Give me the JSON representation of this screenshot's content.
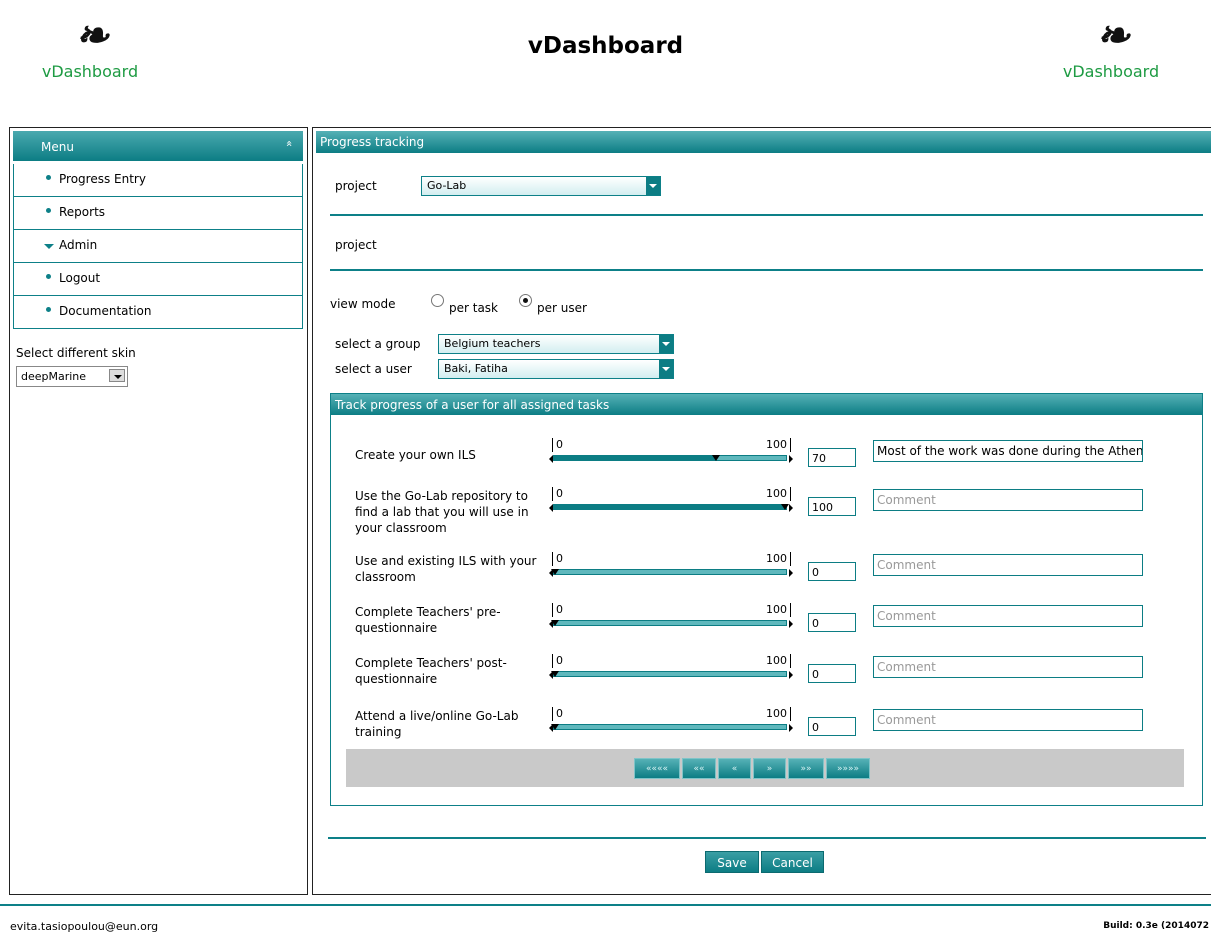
{
  "header": {
    "title": "vDashboard",
    "logo_mark": "❧",
    "logo_name": "vDashboard"
  },
  "sidebar": {
    "menu_title": "Menu",
    "collapse_glyph": "«",
    "items": [
      {
        "label": "Progress Entry",
        "icon": "bullet"
      },
      {
        "label": "Reports",
        "icon": "bullet"
      },
      {
        "label": "Admin",
        "icon": "expand-triangle"
      },
      {
        "label": "Logout",
        "icon": "bullet"
      },
      {
        "label": "Documentation",
        "icon": "bullet"
      }
    ],
    "skin_label": "Select different skin",
    "skin_value": "deepMarine"
  },
  "main": {
    "title": "Progress tracking",
    "project_label": "project",
    "project_value": "Go-Lab",
    "project_heading": "project",
    "view_mode_label": "view mode",
    "view_modes": [
      {
        "label": "per task",
        "selected": false
      },
      {
        "label": "per user",
        "selected": true
      }
    ],
    "group_label": "select a group",
    "group_value": "Belgium teachers",
    "user_label": "select a user",
    "user_value": "Baki, Fatiha"
  },
  "track": {
    "title": "Track progress of a user for all assigned tasks",
    "min_label": "0",
    "max_label": "100",
    "tasks": [
      {
        "label": "Create your own ILS",
        "value": "70",
        "progress": 70,
        "comment": "Most of the work was done during the Athens",
        "comment_placeholder": false
      },
      {
        "label": "Use the Go-Lab repository to find a lab that you will use in your classroom",
        "value": "100",
        "progress": 100,
        "comment": "Comment",
        "comment_placeholder": true
      },
      {
        "label": "Use and existing ILS with your classroom",
        "value": "0",
        "progress": 0,
        "comment": "Comment",
        "comment_placeholder": true
      },
      {
        "label": "Complete Teachers' pre-questionnaire",
        "value": "0",
        "progress": 0,
        "comment": "Comment",
        "comment_placeholder": true
      },
      {
        "label": "Complete Teachers' post-questionnaire",
        "value": "0",
        "progress": 0,
        "comment": "Comment",
        "comment_placeholder": true
      },
      {
        "label": "Attend a live/online Go-Lab training",
        "value": "0",
        "progress": 0,
        "comment": "Comment",
        "comment_placeholder": true
      }
    ],
    "pager": [
      "««««",
      "««",
      "«",
      "»",
      "»»",
      "»»»»"
    ]
  },
  "actions": {
    "save": "Save",
    "cancel": "Cancel"
  },
  "footer": {
    "user_email": "evita.tasiopoulou@eun.org",
    "build": "Build: 0.3e (2014072"
  },
  "colors": {
    "accent": "#0c7d84",
    "brand_green": "#1e9b43"
  }
}
